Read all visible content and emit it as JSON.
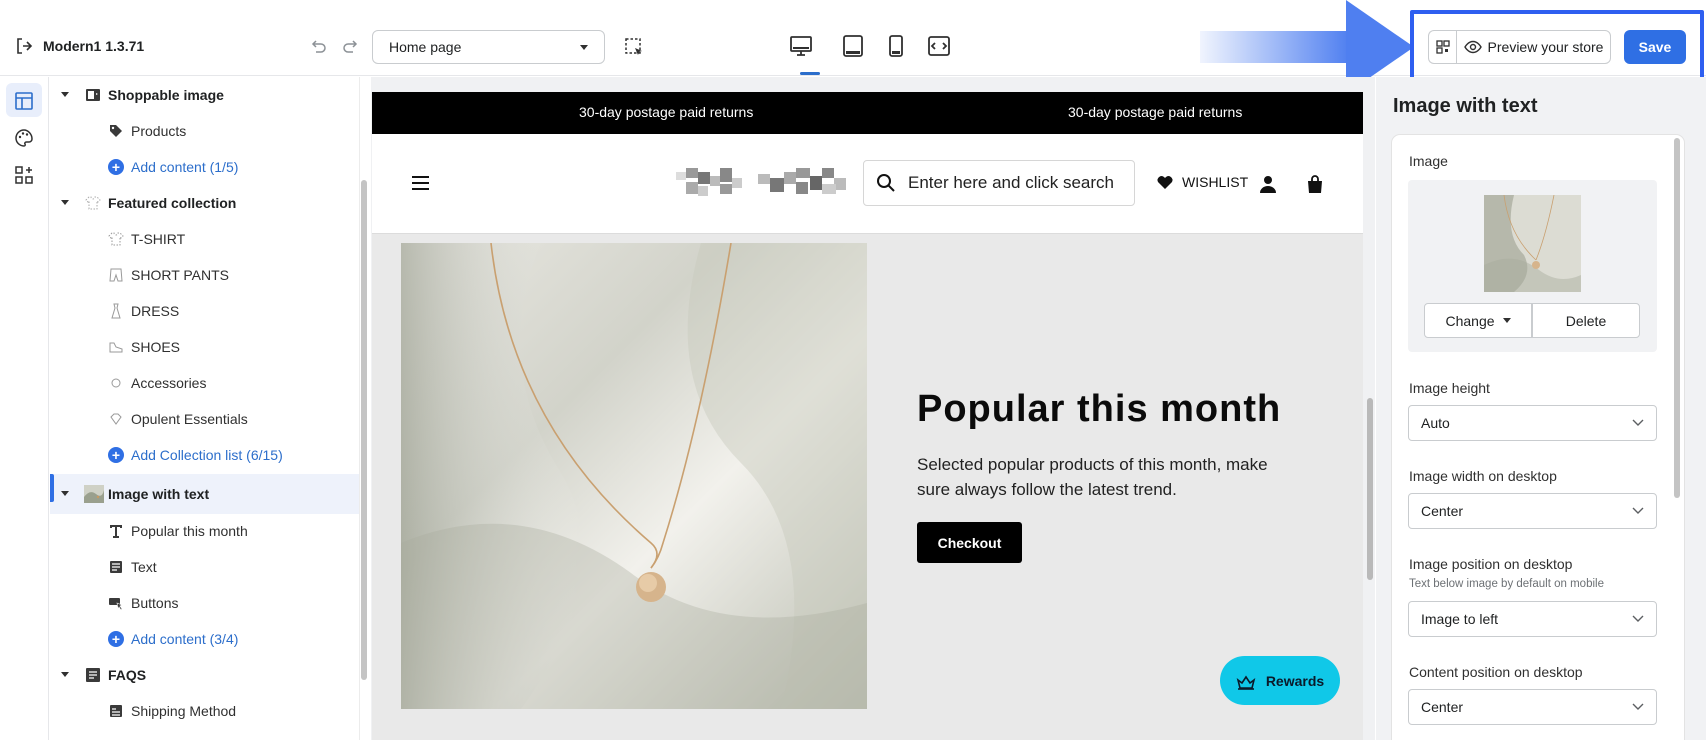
{
  "topbar": {
    "app_name": "Modern1  1.3.71",
    "page_select_value": "Home page",
    "preview_label": "Preview your store",
    "save_label": "Save"
  },
  "sidebar": {
    "sections": [
      {
        "label": "Shoppable image",
        "children": [
          "Products"
        ],
        "add": "Add content (1/5)"
      },
      {
        "label": "Featured collection",
        "children": [
          "T-SHIRT",
          "SHORT PANTS",
          "DRESS",
          "SHOES",
          "Accessories",
          "Opulent Essentials"
        ],
        "add": "Add Collection list (6/15)"
      },
      {
        "label": "Image with text",
        "children": [
          "Popular this month",
          "Text",
          "Buttons"
        ],
        "add": "Add content (3/4)"
      },
      {
        "label": "FAQS",
        "children": [
          "Shipping Method"
        ]
      }
    ]
  },
  "store": {
    "announcement": [
      "30-day postage paid returns",
      "30-day postage paid returns"
    ],
    "search_placeholder": "Enter here and click search",
    "wishlist_label": "WISHLIST",
    "hero_title": "Popular this month",
    "hero_text": "Selected popular products of this month, make sure always follow the latest trend.",
    "checkout_label": "Checkout",
    "rewards_label": "Rewards"
  },
  "panel": {
    "title": "Image with text",
    "image_label": "Image",
    "change_label": "Change",
    "delete_label": "Delete",
    "fields": [
      {
        "label": "Image height",
        "value": "Auto"
      },
      {
        "label": "Image width on desktop",
        "value": "Center"
      },
      {
        "label": "Image position on desktop",
        "hint": "Text below image by default on mobile",
        "value": "Image to left"
      },
      {
        "label": "Content position on desktop",
        "value": "Center"
      }
    ]
  },
  "colors": {
    "accent": "#2f6fe4",
    "rewards": "#10c8e8",
    "announcement_bg": "#000000",
    "highlight": "#2e5ff0"
  }
}
